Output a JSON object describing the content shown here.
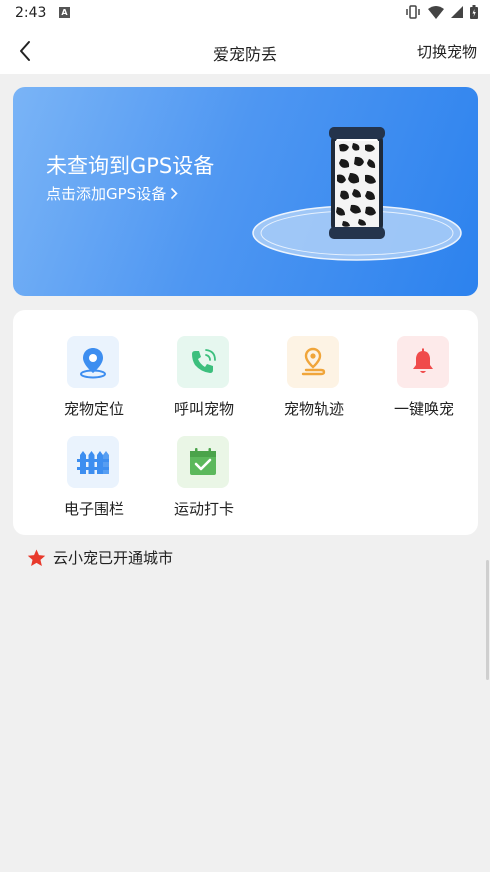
{
  "status_bar": {
    "time": "2:43",
    "notification_letter": "A"
  },
  "nav": {
    "title": "爱宠防丢",
    "action": "切换宠物"
  },
  "banner": {
    "title": "未查询到GPS设备",
    "link": "点击添加GPS设备"
  },
  "features": [
    {
      "label": "宠物定位",
      "icon": "location-pin-icon",
      "bg": "#eaf3fd",
      "color": "#3d8ef0"
    },
    {
      "label": "呼叫宠物",
      "icon": "phone-call-icon",
      "bg": "#e6f7ef",
      "color": "#3cbf7d"
    },
    {
      "label": "宠物轨迹",
      "icon": "track-pin-icon",
      "bg": "#fdf3e4",
      "color": "#f0a53a"
    },
    {
      "label": "一键唤宠",
      "icon": "bell-icon",
      "bg": "#fdeaea",
      "color": "#f04b4b"
    },
    {
      "label": "电子围栏",
      "icon": "fence-icon",
      "bg": "#eaf3fd",
      "color": "#3d8ef0"
    },
    {
      "label": "运动打卡",
      "icon": "calendar-check-icon",
      "bg": "#eaf6e6",
      "color": "#5cb85c"
    }
  ],
  "open_cities": {
    "label": "云小宠已开通城市",
    "icon": "star-icon",
    "color": "#e8392b"
  },
  "colors": {
    "accent": "#2c82ee",
    "background": "#f0f0f0"
  }
}
